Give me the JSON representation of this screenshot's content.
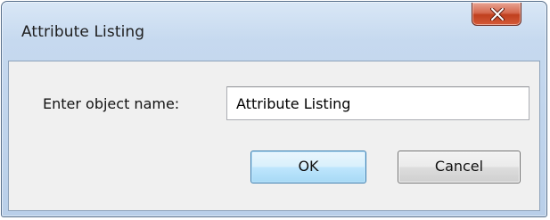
{
  "window": {
    "title": "Attribute Listing"
  },
  "form": {
    "name_label": "Enter object name:",
    "name_value": "Attribute Listing"
  },
  "buttons": {
    "ok_label": "OK",
    "cancel_label": "Cancel"
  },
  "icons": {
    "close": "close-icon"
  },
  "colors": {
    "close_button": "#c94a2c",
    "ok_border": "#3c7fb1",
    "client_bg": "#f0f0f0",
    "frame_bg": "#c6d9ef"
  }
}
